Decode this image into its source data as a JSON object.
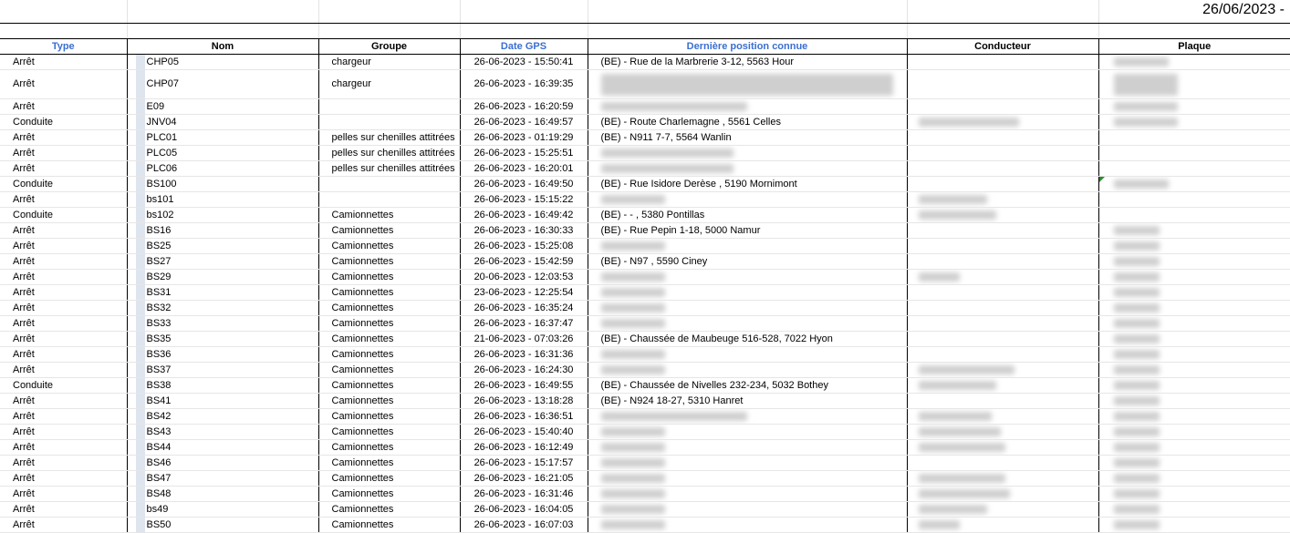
{
  "report": {
    "date": "26/06/2023 -"
  },
  "columns": {
    "type": "Type",
    "nom": "Nom",
    "groupe": "Groupe",
    "date_gps": "Date GPS",
    "position": "Dernière position connue",
    "conducteur": "Conducteur",
    "plaque": "Plaque"
  },
  "rows": [
    {
      "type": "Arrêt",
      "nom": "CHP05",
      "groupe": "chargeur",
      "date": "26-06-2023 - 15:50:41",
      "position": "(BE) - Rue de la Marbrerie 3-12, 5563 Hour"
    },
    {
      "type": "Arrêt",
      "nom": "CHP07",
      "groupe": "chargeur",
      "date": "26-06-2023 - 16:39:35",
      "position": ""
    },
    {
      "type": "Arrêt",
      "nom": "E09",
      "groupe": "",
      "date": "26-06-2023 - 16:20:59",
      "position": ""
    },
    {
      "type": "Conduite",
      "nom": "JNV04",
      "groupe": "",
      "date": "26-06-2023 - 16:49:57",
      "position": "(BE) - Route Charlemagne , 5561 Celles"
    },
    {
      "type": "Arrêt",
      "nom": "PLC01",
      "groupe": "pelles sur chenilles attitrées",
      "date": "26-06-2023 - 01:19:29",
      "position": "(BE) - N911 7-7, 5564 Wanlin"
    },
    {
      "type": "Arrêt",
      "nom": "PLC05",
      "groupe": "pelles sur chenilles attitrées",
      "date": "26-06-2023 - 15:25:51",
      "position": ""
    },
    {
      "type": "Arrêt",
      "nom": "PLC06",
      "groupe": "pelles sur chenilles attitrées",
      "date": "26-06-2023 - 16:20:01",
      "position": ""
    },
    {
      "type": "Conduite",
      "nom": "BS100",
      "groupe": "",
      "date": "26-06-2023 - 16:49:50",
      "position": "(BE) - Rue Isidore Derèse , 5190 Mornimont"
    },
    {
      "type": "Arrêt",
      "nom": "bs101",
      "groupe": "",
      "date": "26-06-2023 - 15:15:22",
      "position": ""
    },
    {
      "type": "Conduite",
      "nom": "bs102",
      "groupe": "Camionnettes",
      "date": "26-06-2023 - 16:49:42",
      "position": "(BE) - - , 5380 Pontillas"
    },
    {
      "type": "Arrêt",
      "nom": "BS16",
      "groupe": "Camionnettes",
      "date": "26-06-2023 - 16:30:33",
      "position": "(BE) - Rue Pepin 1-18, 5000 Namur"
    },
    {
      "type": "Arrêt",
      "nom": "BS25",
      "groupe": "Camionnettes",
      "date": "26-06-2023 - 15:25:08",
      "position": ""
    },
    {
      "type": "Arrêt",
      "nom": "BS27",
      "groupe": "Camionnettes",
      "date": "26-06-2023 - 15:42:59",
      "position": "(BE) - N97 , 5590 Ciney"
    },
    {
      "type": "Arrêt",
      "nom": "BS29",
      "groupe": "Camionnettes",
      "date": "20-06-2023 - 12:03:53",
      "position": ""
    },
    {
      "type": "Arrêt",
      "nom": "BS31",
      "groupe": "Camionnettes",
      "date": "23-06-2023 - 12:25:54",
      "position": ""
    },
    {
      "type": "Arrêt",
      "nom": "BS32",
      "groupe": "Camionnettes",
      "date": "26-06-2023 - 16:35:24",
      "position": ""
    },
    {
      "type": "Arrêt",
      "nom": "BS33",
      "groupe": "Camionnettes",
      "date": "26-06-2023 - 16:37:47",
      "position": ""
    },
    {
      "type": "Arrêt",
      "nom": "BS35",
      "groupe": "Camionnettes",
      "date": "21-06-2023 - 07:03:26",
      "position": "(BE) - Chaussée de Maubeuge 516-528, 7022 Hyon"
    },
    {
      "type": "Arrêt",
      "nom": "BS36",
      "groupe": "Camionnettes",
      "date": "26-06-2023 - 16:31:36",
      "position": ""
    },
    {
      "type": "Arrêt",
      "nom": "BS37",
      "groupe": "Camionnettes",
      "date": "26-06-2023 - 16:24:30",
      "position": ""
    },
    {
      "type": "Conduite",
      "nom": "BS38",
      "groupe": "Camionnettes",
      "date": "26-06-2023 - 16:49:55",
      "position": "(BE) - Chaussée de Nivelles 232-234, 5032 Bothey"
    },
    {
      "type": "Arrêt",
      "nom": "BS41",
      "groupe": "Camionnettes",
      "date": "26-06-2023 - 13:18:28",
      "position": "(BE) - N924 18-27, 5310 Hanret"
    },
    {
      "type": "Arrêt",
      "nom": "BS42",
      "groupe": "Camionnettes",
      "date": "26-06-2023 - 16:36:51",
      "position": ""
    },
    {
      "type": "Arrêt",
      "nom": "BS43",
      "groupe": "Camionnettes",
      "date": "26-06-2023 - 15:40:40",
      "position": ""
    },
    {
      "type": "Arrêt",
      "nom": "BS44",
      "groupe": "Camionnettes",
      "date": "26-06-2023 - 16:12:49",
      "position": ""
    },
    {
      "type": "Arrêt",
      "nom": "BS46",
      "groupe": "Camionnettes",
      "date": "26-06-2023 - 15:17:57",
      "position": ""
    },
    {
      "type": "Arrêt",
      "nom": "BS47",
      "groupe": "Camionnettes",
      "date": "26-06-2023 - 16:21:05",
      "position": ""
    },
    {
      "type": "Arrêt",
      "nom": "BS48",
      "groupe": "Camionnettes",
      "date": "26-06-2023 - 16:31:46",
      "position": ""
    },
    {
      "type": "Arrêt",
      "nom": "bs49",
      "groupe": "Camionnettes",
      "date": "26-06-2023 - 16:04:05",
      "position": ""
    },
    {
      "type": "Arrêt",
      "nom": "BS50",
      "groupe": "Camionnettes",
      "date": "26-06-2023 - 16:07:03",
      "position": ""
    }
  ],
  "colors": {
    "header_blue": "#3a6fd0",
    "redaction": "#cfcfcf",
    "cell_marker": "#2e8b2e"
  }
}
